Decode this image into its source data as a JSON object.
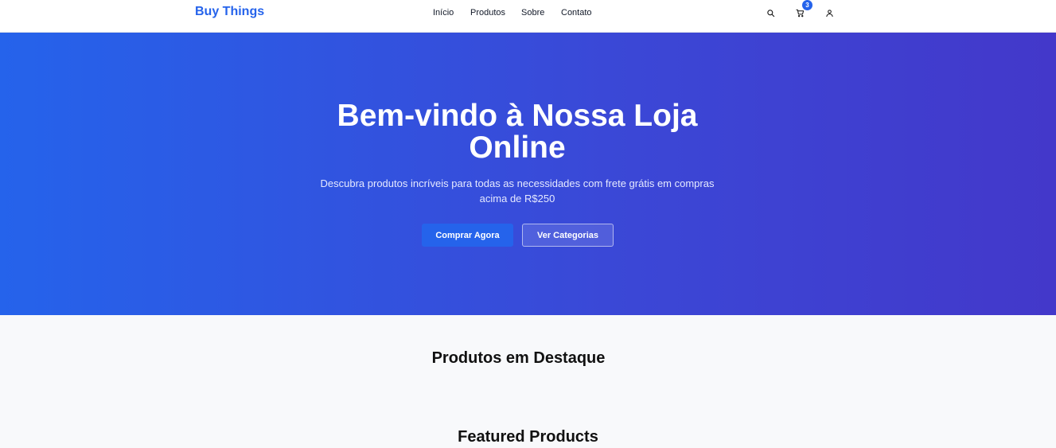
{
  "brand": {
    "name": "Buy Things",
    "color": "#2563eb"
  },
  "nav": {
    "links": [
      "Início",
      "Produtos",
      "Sobre",
      "Contato"
    ]
  },
  "header_icons": {
    "search": "search-icon",
    "cart": "cart-icon",
    "user": "user-icon",
    "cart_count": "3"
  },
  "hero": {
    "title": "Bem-vindo à Nossa Loja Online",
    "subtitle": "Descubra produtos incríveis para todas as necessidades com frete grátis em compras acima de R$250",
    "primary_button": "Comprar Agora",
    "secondary_button": "Ver Categorias",
    "gradient_start": "#2563eb",
    "gradient_end": "#4338ca"
  },
  "sections": {
    "featured_pt": "Produtos em Destaque",
    "featured_en": "Featured Products"
  }
}
